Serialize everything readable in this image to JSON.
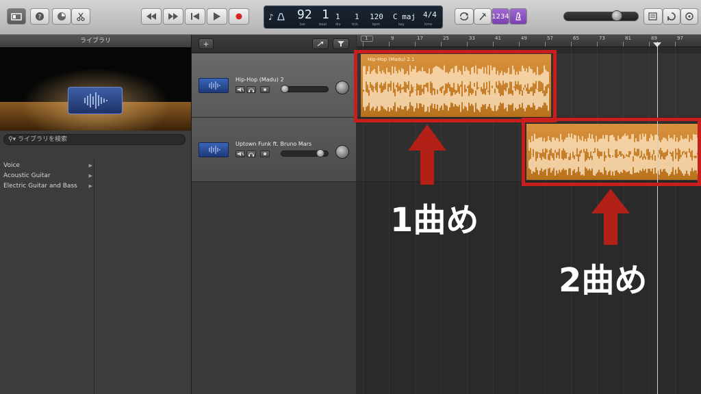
{
  "toolbar": {
    "lcd": {
      "bar": "92",
      "beat": "1",
      "div": "1",
      "tick": "1",
      "tempo": "120",
      "key": "C maj",
      "time_sig": "4/4",
      "sub_bar": "bar",
      "sub_beat": "beat",
      "sub_div": "div",
      "sub_tick": "tick",
      "sub_tempo": "bpm",
      "sub_key": "key",
      "sub_sig": "time"
    },
    "count_in_label": "1234"
  },
  "library": {
    "title": "ライブラリ",
    "search_placeholder": "ライブラリを検索",
    "items": [
      {
        "label": "Voice"
      },
      {
        "label": "Acoustic Guitar"
      },
      {
        "label": "Electric Guitar and Bass"
      }
    ]
  },
  "tracks_header": {
    "add_label": "+"
  },
  "tracks": [
    {
      "name": "Hip-Hop (Madu) 2",
      "volume": 0.0
    },
    {
      "name": "Uptown Funk ft. Bruno Mars",
      "volume": 0.75
    }
  ],
  "ruler": {
    "marks": [
      "1",
      "9",
      "17",
      "25",
      "33",
      "41",
      "49",
      "57",
      "65",
      "73",
      "81",
      "89",
      "97"
    ]
  },
  "regions": [
    {
      "label": "Hip-Hop (Madu) 2.1"
    },
    {
      "label": ""
    }
  ],
  "annotations": {
    "first": "1曲め",
    "second": "2曲め"
  },
  "colors": {
    "region_orange": "#d08a34",
    "highlight_red": "#c81e1e",
    "arrow_red": "#b22018"
  }
}
